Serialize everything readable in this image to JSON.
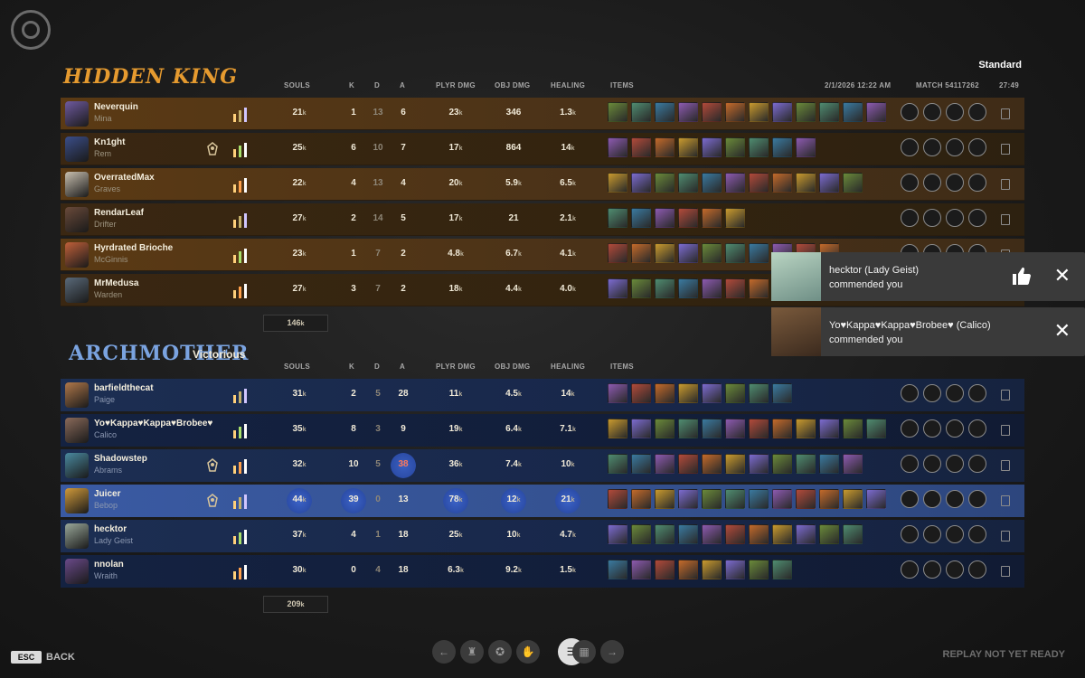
{
  "header": {
    "team1_name": "HIDDEN KING",
    "team2_name": "ARCHMOTHER",
    "team2_result": "Victorious",
    "mode": "Standard",
    "date": "2/1/2026 12:22 AM",
    "match": "MATCH 54117262",
    "duration": "27:49"
  },
  "columns": {
    "souls": "SOULS",
    "k": "K",
    "d": "D",
    "a": "A",
    "plyr_dmg": "PLYR DMG",
    "obj_dmg": "OBJ DMG",
    "healing": "HEALING",
    "items": "ITEMS"
  },
  "team1": {
    "color": "#e59a2f",
    "total_souls": "146",
    "total_unit": "k",
    "players": [
      {
        "name": "Neverquin",
        "hero": "Mina",
        "souls": "21",
        "k": "1",
        "d": "13",
        "a": "6",
        "plyr_dmg": "23",
        "plyr_unit": "k",
        "obj_dmg": "346",
        "obj_unit": "",
        "healing": "1.3",
        "heal_unit": "k",
        "rank_icon": false
      },
      {
        "name": "Kn1ght",
        "hero": "Rem",
        "souls": "25",
        "k": "6",
        "d": "10",
        "a": "7",
        "plyr_dmg": "17",
        "plyr_unit": "k",
        "obj_dmg": "864",
        "obj_unit": "",
        "healing": "14",
        "heal_unit": "k",
        "rank_icon": true
      },
      {
        "name": "OverratedMax",
        "hero": "Graves",
        "souls": "22",
        "k": "4",
        "d": "13",
        "a": "4",
        "plyr_dmg": "20",
        "plyr_unit": "k",
        "obj_dmg": "5.9",
        "obj_unit": "k",
        "healing": "6.5",
        "heal_unit": "k",
        "rank_icon": false
      },
      {
        "name": "RendarLeaf",
        "hero": "Drifter",
        "souls": "27",
        "k": "2",
        "d": "14",
        "a": "5",
        "plyr_dmg": "17",
        "plyr_unit": "k",
        "obj_dmg": "21",
        "obj_unit": "",
        "healing": "2.1",
        "heal_unit": "k",
        "rank_icon": false
      },
      {
        "name": "Hyrdrated Brioche",
        "hero": "McGinnis",
        "souls": "23",
        "k": "1",
        "d": "7",
        "a": "2",
        "plyr_dmg": "4.8",
        "plyr_unit": "k",
        "obj_dmg": "6.7",
        "obj_unit": "k",
        "healing": "4.1",
        "heal_unit": "k",
        "rank_icon": false
      },
      {
        "name": "MrMedusa",
        "hero": "Warden",
        "souls": "27",
        "k": "3",
        "d": "7",
        "a": "2",
        "plyr_dmg": "18",
        "plyr_unit": "k",
        "obj_dmg": "4.4",
        "obj_unit": "k",
        "healing": "4.0",
        "heal_unit": "k",
        "rank_icon": false
      }
    ]
  },
  "team2": {
    "color": "#7aa3e0",
    "total_souls": "209",
    "total_unit": "k",
    "players": [
      {
        "name": "barfieldthecat",
        "hero": "Paige",
        "souls": "31",
        "k": "2",
        "d": "5",
        "a": "28",
        "plyr_dmg": "11",
        "plyr_unit": "k",
        "obj_dmg": "4.5",
        "obj_unit": "k",
        "healing": "14",
        "heal_unit": "k",
        "rank_icon": false
      },
      {
        "name": "Yo♥Kappa♥Kappa♥Brobee♥",
        "hero": "Calico",
        "souls": "35",
        "k": "8",
        "d": "3",
        "a": "9",
        "plyr_dmg": "19",
        "plyr_unit": "k",
        "obj_dmg": "6.4",
        "obj_unit": "k",
        "healing": "7.1",
        "heal_unit": "k",
        "rank_icon": false
      },
      {
        "name": "Shadowstep",
        "hero": "Abrams",
        "souls": "32",
        "k": "10",
        "d": "5",
        "a": "38",
        "plyr_dmg": "36",
        "plyr_unit": "k",
        "obj_dmg": "7.4",
        "obj_unit": "k",
        "healing": "10",
        "heal_unit": "k",
        "rank_icon": true
      },
      {
        "name": "Juicer",
        "hero": "Bebop",
        "souls": "44",
        "k": "39",
        "d": "0",
        "a": "13",
        "plyr_dmg": "78",
        "plyr_unit": "k",
        "obj_dmg": "12",
        "obj_unit": "k",
        "healing": "21",
        "heal_unit": "k",
        "rank_icon": true,
        "self": true
      },
      {
        "name": "hecktor",
        "hero": "Lady Geist",
        "souls": "37",
        "k": "4",
        "d": "1",
        "a": "18",
        "plyr_dmg": "25",
        "plyr_unit": "k",
        "obj_dmg": "10",
        "obj_unit": "k",
        "healing": "4.7",
        "heal_unit": "k",
        "rank_icon": false
      },
      {
        "name": "nnolan",
        "hero": "Wraith",
        "souls": "30",
        "k": "0",
        "d": "4",
        "a": "18",
        "plyr_dmg": "6.3",
        "plyr_unit": "k",
        "obj_dmg": "9.2",
        "obj_unit": "k",
        "healing": "1.5",
        "heal_unit": "k",
        "rank_icon": false
      }
    ]
  },
  "notifications": [
    {
      "title": "hecktor (Lady Geist)",
      "body": "commended you",
      "like_icon": "thumbs-up-icon",
      "close_icon": "✕"
    },
    {
      "title": "Yo♥Kappa♥Kappa♥Brobee♥ (Calico)",
      "body": "commended you",
      "close_icon": "✕"
    }
  ],
  "footer": {
    "esc_label": "ESC",
    "back_label": "BACK",
    "replay_status": "REPLAY NOT YET READY",
    "nav": [
      "prev-arrow-icon",
      "trophy-icon",
      "medal-icon",
      "hand-icon",
      "list-icon",
      "chart-icon",
      "next-arrow-icon"
    ],
    "nav_active": 4
  },
  "palette": {
    "item_colors": [
      "#6a8a3a",
      "#8d5ab0",
      "#c99a2e",
      "#4f8c70",
      "#b24a3a",
      "#7c6bd0",
      "#3a7aa0",
      "#c46a2a"
    ]
  }
}
